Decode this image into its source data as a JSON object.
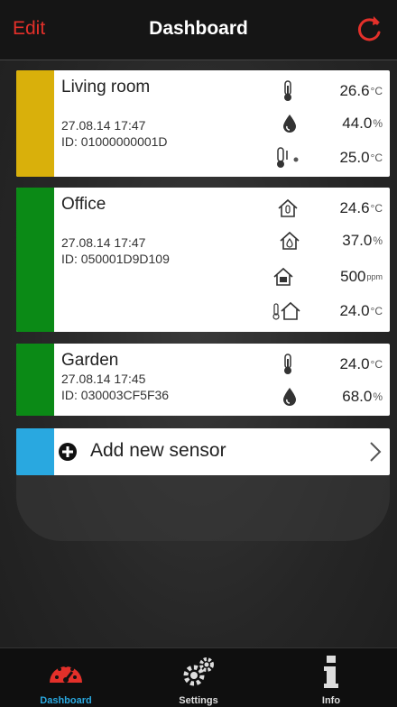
{
  "header": {
    "edit_label": "Edit",
    "title": "Dashboard"
  },
  "colors": {
    "accent_red": "#e3302a",
    "stripe_yellow": "#d9b00b",
    "stripe_green": "#0b8a16",
    "stripe_blue": "#29a8e0",
    "tab_active": "#29a8e0"
  },
  "sensors": [
    {
      "name": "Living room",
      "datetime": "27.08.14   17:47",
      "id": "ID: 01000000001D",
      "readings": [
        {
          "icon": "thermometer-icon",
          "value": "26.6",
          "unit": "°C"
        },
        {
          "icon": "water-drop-icon",
          "value": "44.0",
          "unit": "%"
        },
        {
          "icon": "dewpoint-thermometer-icon",
          "value": "25.0",
          "unit": "°C"
        }
      ]
    },
    {
      "name": "Office",
      "datetime": "27.08.14   17:47",
      "id": "ID: 050001D9D109",
      "readings": [
        {
          "icon": "house-thermometer-icon",
          "value": "24.6",
          "unit": "°C"
        },
        {
          "icon": "house-drop-icon",
          "value": "37.0",
          "unit": "%"
        },
        {
          "icon": "house-co2-icon",
          "value": "500",
          "unit": "ppm"
        },
        {
          "icon": "outdoor-house-thermometer-icon",
          "value": "24.0",
          "unit": "°C"
        }
      ]
    },
    {
      "name": "Garden",
      "datetime": "27.08.14   17:45",
      "id": "ID: 030003CF5F36",
      "readings": [
        {
          "icon": "thermometer-icon",
          "value": "24.0",
          "unit": "°C"
        },
        {
          "icon": "water-drop-icon",
          "value": "68.0",
          "unit": "%"
        }
      ]
    }
  ],
  "add_sensor": {
    "label": "Add new sensor"
  },
  "tabs": [
    {
      "label": "Dashboard",
      "icon": "speedometer-icon",
      "active": true
    },
    {
      "label": "Settings",
      "icon": "gears-icon",
      "active": false
    },
    {
      "label": "Info",
      "icon": "info-icon",
      "active": false
    }
  ]
}
